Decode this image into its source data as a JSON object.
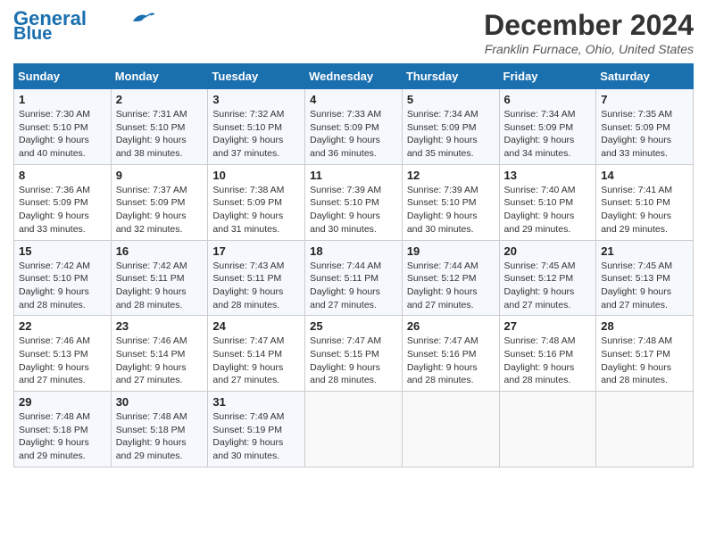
{
  "header": {
    "logo_line1": "General",
    "logo_line2": "Blue",
    "month_title": "December 2024",
    "location": "Franklin Furnace, Ohio, United States"
  },
  "weekdays": [
    "Sunday",
    "Monday",
    "Tuesday",
    "Wednesday",
    "Thursday",
    "Friday",
    "Saturday"
  ],
  "weeks": [
    [
      {
        "day": "1",
        "info": "Sunrise: 7:30 AM\nSunset: 5:10 PM\nDaylight: 9 hours\nand 40 minutes."
      },
      {
        "day": "2",
        "info": "Sunrise: 7:31 AM\nSunset: 5:10 PM\nDaylight: 9 hours\nand 38 minutes."
      },
      {
        "day": "3",
        "info": "Sunrise: 7:32 AM\nSunset: 5:10 PM\nDaylight: 9 hours\nand 37 minutes."
      },
      {
        "day": "4",
        "info": "Sunrise: 7:33 AM\nSunset: 5:09 PM\nDaylight: 9 hours\nand 36 minutes."
      },
      {
        "day": "5",
        "info": "Sunrise: 7:34 AM\nSunset: 5:09 PM\nDaylight: 9 hours\nand 35 minutes."
      },
      {
        "day": "6",
        "info": "Sunrise: 7:34 AM\nSunset: 5:09 PM\nDaylight: 9 hours\nand 34 minutes."
      },
      {
        "day": "7",
        "info": "Sunrise: 7:35 AM\nSunset: 5:09 PM\nDaylight: 9 hours\nand 33 minutes."
      }
    ],
    [
      {
        "day": "8",
        "info": "Sunrise: 7:36 AM\nSunset: 5:09 PM\nDaylight: 9 hours\nand 33 minutes."
      },
      {
        "day": "9",
        "info": "Sunrise: 7:37 AM\nSunset: 5:09 PM\nDaylight: 9 hours\nand 32 minutes."
      },
      {
        "day": "10",
        "info": "Sunrise: 7:38 AM\nSunset: 5:09 PM\nDaylight: 9 hours\nand 31 minutes."
      },
      {
        "day": "11",
        "info": "Sunrise: 7:39 AM\nSunset: 5:10 PM\nDaylight: 9 hours\nand 30 minutes."
      },
      {
        "day": "12",
        "info": "Sunrise: 7:39 AM\nSunset: 5:10 PM\nDaylight: 9 hours\nand 30 minutes."
      },
      {
        "day": "13",
        "info": "Sunrise: 7:40 AM\nSunset: 5:10 PM\nDaylight: 9 hours\nand 29 minutes."
      },
      {
        "day": "14",
        "info": "Sunrise: 7:41 AM\nSunset: 5:10 PM\nDaylight: 9 hours\nand 29 minutes."
      }
    ],
    [
      {
        "day": "15",
        "info": "Sunrise: 7:42 AM\nSunset: 5:10 PM\nDaylight: 9 hours\nand 28 minutes."
      },
      {
        "day": "16",
        "info": "Sunrise: 7:42 AM\nSunset: 5:11 PM\nDaylight: 9 hours\nand 28 minutes."
      },
      {
        "day": "17",
        "info": "Sunrise: 7:43 AM\nSunset: 5:11 PM\nDaylight: 9 hours\nand 28 minutes."
      },
      {
        "day": "18",
        "info": "Sunrise: 7:44 AM\nSunset: 5:11 PM\nDaylight: 9 hours\nand 27 minutes."
      },
      {
        "day": "19",
        "info": "Sunrise: 7:44 AM\nSunset: 5:12 PM\nDaylight: 9 hours\nand 27 minutes."
      },
      {
        "day": "20",
        "info": "Sunrise: 7:45 AM\nSunset: 5:12 PM\nDaylight: 9 hours\nand 27 minutes."
      },
      {
        "day": "21",
        "info": "Sunrise: 7:45 AM\nSunset: 5:13 PM\nDaylight: 9 hours\nand 27 minutes."
      }
    ],
    [
      {
        "day": "22",
        "info": "Sunrise: 7:46 AM\nSunset: 5:13 PM\nDaylight: 9 hours\nand 27 minutes."
      },
      {
        "day": "23",
        "info": "Sunrise: 7:46 AM\nSunset: 5:14 PM\nDaylight: 9 hours\nand 27 minutes."
      },
      {
        "day": "24",
        "info": "Sunrise: 7:47 AM\nSunset: 5:14 PM\nDaylight: 9 hours\nand 27 minutes."
      },
      {
        "day": "25",
        "info": "Sunrise: 7:47 AM\nSunset: 5:15 PM\nDaylight: 9 hours\nand 28 minutes."
      },
      {
        "day": "26",
        "info": "Sunrise: 7:47 AM\nSunset: 5:16 PM\nDaylight: 9 hours\nand 28 minutes."
      },
      {
        "day": "27",
        "info": "Sunrise: 7:48 AM\nSunset: 5:16 PM\nDaylight: 9 hours\nand 28 minutes."
      },
      {
        "day": "28",
        "info": "Sunrise: 7:48 AM\nSunset: 5:17 PM\nDaylight: 9 hours\nand 28 minutes."
      }
    ],
    [
      {
        "day": "29",
        "info": "Sunrise: 7:48 AM\nSunset: 5:18 PM\nDaylight: 9 hours\nand 29 minutes."
      },
      {
        "day": "30",
        "info": "Sunrise: 7:48 AM\nSunset: 5:18 PM\nDaylight: 9 hours\nand 29 minutes."
      },
      {
        "day": "31",
        "info": "Sunrise: 7:49 AM\nSunset: 5:19 PM\nDaylight: 9 hours\nand 30 minutes."
      },
      {
        "day": "",
        "info": ""
      },
      {
        "day": "",
        "info": ""
      },
      {
        "day": "",
        "info": ""
      },
      {
        "day": "",
        "info": ""
      }
    ]
  ]
}
